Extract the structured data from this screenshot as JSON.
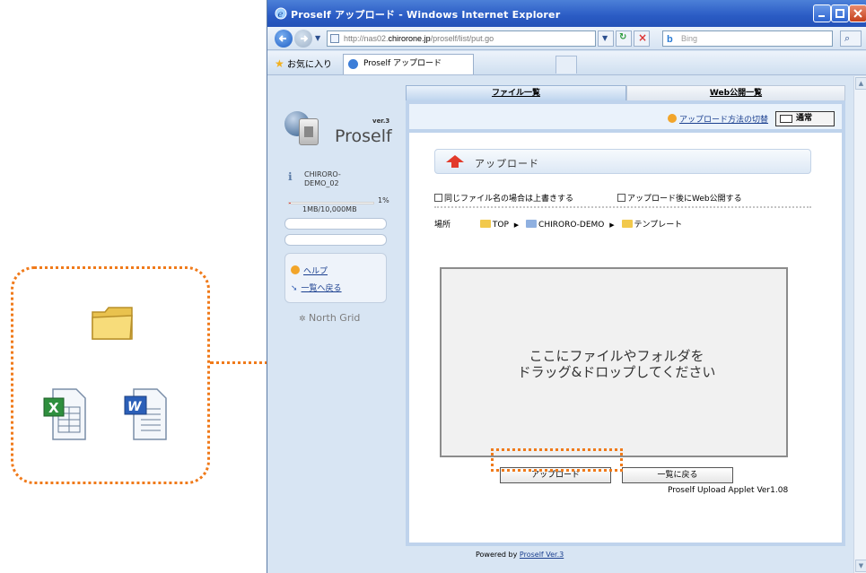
{
  "window": {
    "title": "Proself アップロード - Windows Internet Explorer"
  },
  "address_bar": {
    "url_prefix": "http://nas02.",
    "url_domain": "chirorone.jp",
    "url_path": "/proself/list/put.go",
    "search_placeholder": "Bing"
  },
  "favorites_bar": {
    "favorites_label": "お気に入り",
    "tab_label": "Proself アップロード"
  },
  "sidebar": {
    "logo_version": "ver.3",
    "logo_text": "Proself",
    "user_name_line1": "CHIRORO-",
    "user_name_line2": "DEMO_02",
    "quota_percent_label": "1%",
    "quota_fraction": 0.01,
    "quota_used": "1MB/10,000MB",
    "links": [
      {
        "label": "ヘルプ"
      },
      {
        "label": "一覧へ戻る"
      }
    ],
    "brand_footer": "North Grid"
  },
  "main": {
    "tabs": [
      {
        "label": "ファイル一覧",
        "active": true
      },
      {
        "label": "Web公開一覧",
        "active": false
      }
    ],
    "switch_method_link": "アップロード方法の切替",
    "mode_button": "通常",
    "upload_title": "アップロード",
    "options": [
      {
        "label": "同じファイル名の場合は上書きする",
        "checked": false
      },
      {
        "label": "アップロード後にWeb公開する",
        "checked": false
      }
    ],
    "location": {
      "label": "場所",
      "path": [
        "TOP",
        "CHIRORO-DEMO",
        "テンプレート"
      ]
    },
    "dropzone_line1": "ここにファイルやフォルダを",
    "dropzone_line2": "ドラッグ&ドロップしてください",
    "upload_button": "アップロード",
    "back_button": "一覧に戻る",
    "applet_version": "Proself Upload Applet Ver1.08"
  },
  "footer": {
    "powered_by": "Powered by",
    "powered_link": "Proself Ver.3"
  },
  "colors": {
    "accent_dotted": "#f07a1a",
    "title_bar": "#2a5bc4",
    "link": "#1a3f8f"
  },
  "illustration_icons": [
    "folder-icon",
    "excel-file-icon",
    "word-file-icon"
  ]
}
